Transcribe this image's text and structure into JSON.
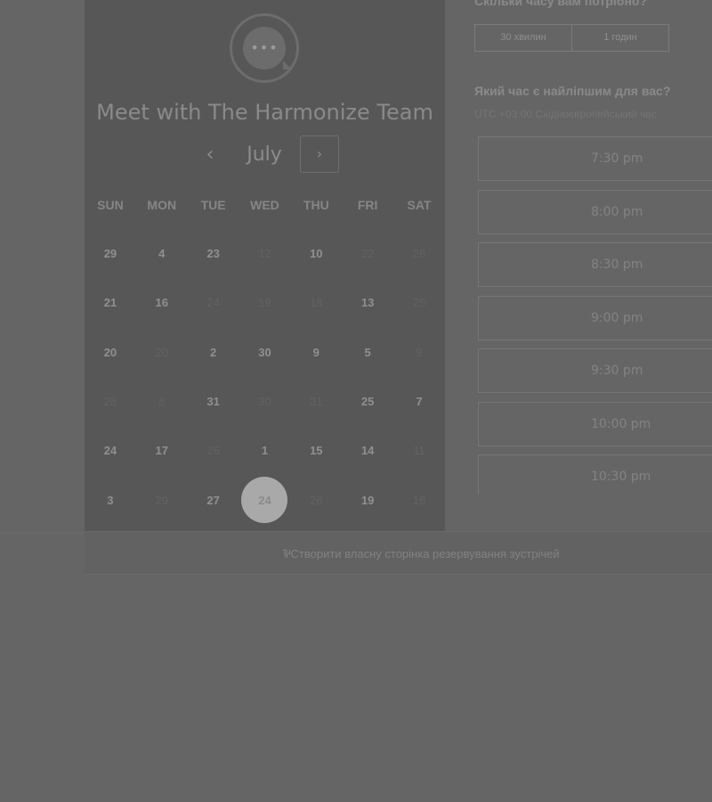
{
  "organizer": {
    "name": "Meet with The Harmonize Team",
    "avatar_icon": "chat-bubble-icon"
  },
  "calendar": {
    "month": "July",
    "prev_icon": "chevron-left-icon",
    "next_icon": "chevron-right-icon",
    "weekdays": [
      "SUN",
      "MON",
      "TUE",
      "WED",
      "THU",
      "FRI",
      "SAT"
    ],
    "days": [
      {
        "label": "29",
        "available": true
      },
      {
        "label": "4",
        "available": true
      },
      {
        "label": "23",
        "available": true
      },
      {
        "label": "12",
        "available": false
      },
      {
        "label": "10",
        "available": true
      },
      {
        "label": "22",
        "available": false
      },
      {
        "label": "28",
        "available": false
      },
      {
        "label": "21",
        "available": true
      },
      {
        "label": "16",
        "available": true
      },
      {
        "label": "24",
        "available": false
      },
      {
        "label": "19",
        "available": false
      },
      {
        "label": "18",
        "available": false
      },
      {
        "label": "13",
        "available": true
      },
      {
        "label": "25",
        "available": false
      },
      {
        "label": "20",
        "available": true
      },
      {
        "label": "20",
        "available": false
      },
      {
        "label": "2",
        "available": true
      },
      {
        "label": "30",
        "available": true
      },
      {
        "label": "9",
        "available": true
      },
      {
        "label": "5",
        "available": true
      },
      {
        "label": "9",
        "available": false
      },
      {
        "label": "28",
        "available": false
      },
      {
        "label": "8",
        "available": false
      },
      {
        "label": "31",
        "available": true
      },
      {
        "label": "30",
        "available": false
      },
      {
        "label": "31",
        "available": false
      },
      {
        "label": "25",
        "available": true
      },
      {
        "label": "7",
        "available": true
      },
      {
        "label": "24",
        "available": true
      },
      {
        "label": "17",
        "available": true
      },
      {
        "label": "26",
        "available": false
      },
      {
        "label": "1",
        "available": true
      },
      {
        "label": "15",
        "available": true
      },
      {
        "label": "14",
        "available": true
      },
      {
        "label": "11",
        "available": false
      },
      {
        "label": "3",
        "available": true
      },
      {
        "label": "29",
        "available": false
      },
      {
        "label": "27",
        "available": true
      },
      {
        "label": "24",
        "available": true,
        "selected": true
      },
      {
        "label": "26",
        "available": false
      },
      {
        "label": "19",
        "available": true
      },
      {
        "label": "16",
        "available": false
      }
    ]
  },
  "duration": {
    "question": "Скільки часу вам потрібно?",
    "options": [
      "30 хвилин",
      "1 годин"
    ]
  },
  "times": {
    "question": "Який час є найліпшим для вас?",
    "timezone": "UTC +03:00 Східноєвропейський час",
    "slots": [
      "7:30 pm",
      "8:00 pm",
      "8:30 pm",
      "9:00 pm",
      "9:30 pm",
      "10:00 pm",
      "10:30 pm"
    ]
  },
  "footer": {
    "icon": "hubspot-sprocket-icon",
    "link": "Створити власну сторінка резервування зустрічей"
  }
}
